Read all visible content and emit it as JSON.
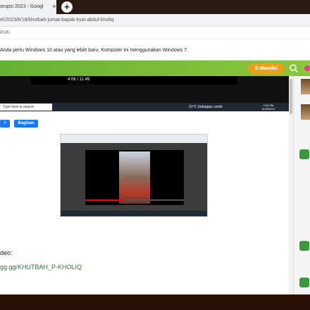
{
  "browser": {
    "tab_title": "orupsi 2023 - Googl",
    "tab_close": "×",
    "new_tab": "+",
    "url": "el/2023/8/18/khutbah-jumat-bapak-kyai-abdul-kholiq",
    "bookmarks_text": "PUR..",
    "info_message": "Anda perlu Windows 10 atau yang lebih baru. Komputer ini menggunakan Windows 7."
  },
  "site_header": {
    "emandiri_label": "E-Mandiri"
  },
  "screenshot_top": {
    "player_time": "4:06 / 11:49",
    "taskbar_search": "Type here to search",
    "weather": "31°C Sebagian cerah",
    "clock_time": "2:33 PM",
    "clock_date": "8/18/2023"
  },
  "share": {
    "count": "0",
    "button_label": "Bagikan"
  },
  "article": {
    "video_label": "deo:",
    "link_text": "gg.gg/KHUTBAH_P-KHOLIQ"
  },
  "colors": {
    "header_green": "#66b232",
    "emandiri_orange": "#e8a21a",
    "facebook_blue": "#1877f2",
    "link_green": "#2a7a3a"
  }
}
